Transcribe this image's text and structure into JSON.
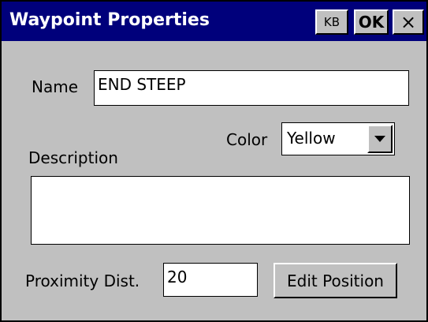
{
  "window": {
    "title": "Waypoint Properties",
    "kb_label": "KB",
    "ok_label": "OK",
    "close_label": "×"
  },
  "form": {
    "name_label": "Name",
    "name_value": "END STEEP",
    "color_label": "Color",
    "color_value": "Yellow",
    "description_label": "Description",
    "description_value": "",
    "proximity_label": "Proximity Dist.",
    "proximity_value": "20",
    "edit_position_label": "Edit Position"
  },
  "colors": {
    "titlebar": "#00007b",
    "face": "#c0c0c0"
  }
}
